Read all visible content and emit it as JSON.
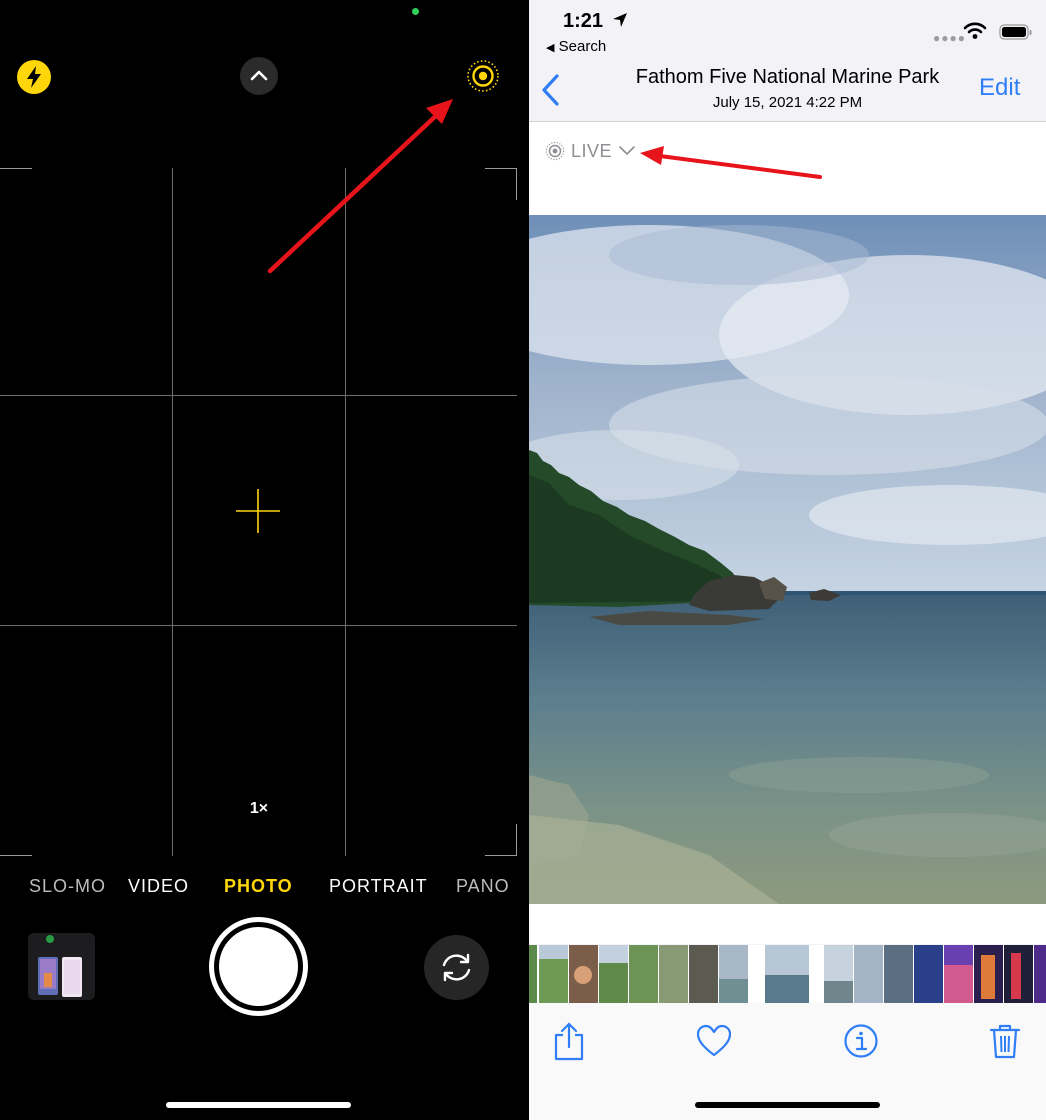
{
  "camera": {
    "zoom_label": "1×",
    "modes": [
      "SLO-MO",
      "VIDEO",
      "PHOTO",
      "PORTRAIT",
      "PANO"
    ],
    "active_mode": "PHOTO",
    "accent_color": "#ffd60a",
    "icons": {
      "flash": "flash-bolt-icon",
      "expand": "chevron-up-icon",
      "live": "live-photo-icon",
      "flip": "camera-flip-icon"
    }
  },
  "photos": {
    "status": {
      "time": "1:21",
      "back_app": "Search"
    },
    "nav": {
      "title": "Fathom Five National Marine Park",
      "subtitle": "July 15, 2021  4:22 PM",
      "edit_label": "Edit"
    },
    "live_badge": "LIVE",
    "accent_color": "#2f7ef6",
    "toolbar": {
      "icons": [
        "share-icon",
        "heart-icon",
        "info-icon",
        "trash-icon"
      ]
    }
  },
  "annotation_color": "#e8141c"
}
